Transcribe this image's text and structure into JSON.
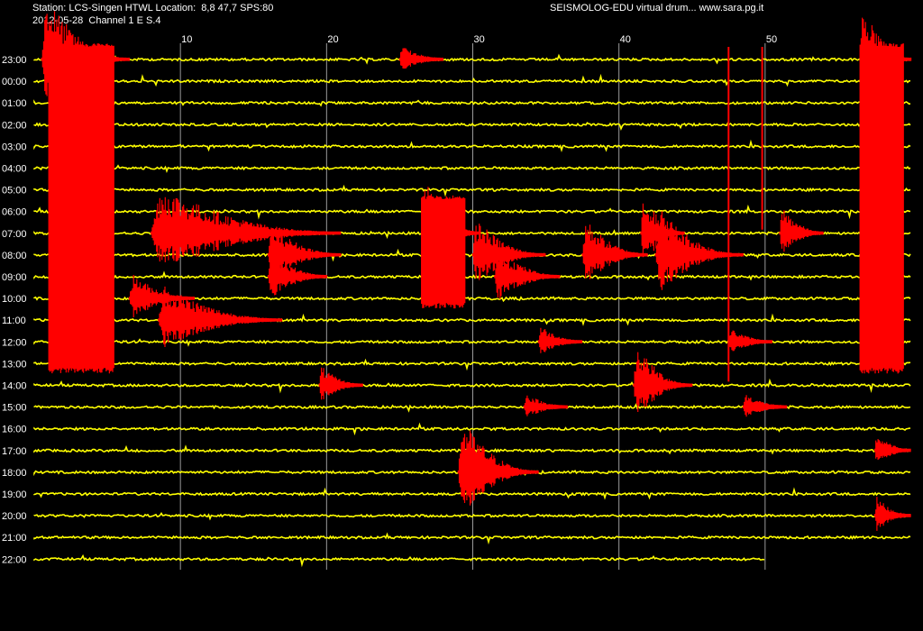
{
  "header": {
    "station_line": "Station: LCS-Singen HTWL Location:  8,8 47,7 SPS:80",
    "date_line": "2012-05-28  Channel 1 E S.4",
    "brand_line": "SEISMOLOG-EDU virtual drum... www.sara.pg.it"
  },
  "colors": {
    "background": "#000000",
    "trace": "#ffff00",
    "event": "#ff0000",
    "gridline": "#9a9a9a",
    "text": "#ffffff"
  },
  "chart_data": {
    "type": "heatmap",
    "title": "",
    "xlabel": "",
    "ylabel": "",
    "x_ticks": [
      10,
      20,
      30,
      40,
      50
    ],
    "xlim": [
      0,
      60
    ],
    "x_unit": "minutes",
    "grid": true,
    "rows": [
      "23:00",
      "00:00",
      "01:00",
      "02:00",
      "03:00",
      "04:00",
      "05:00",
      "06:00",
      "07:00",
      "08:00",
      "09:00",
      "10:00",
      "11:00",
      "12:00",
      "13:00",
      "14:00",
      "15:00",
      "16:00",
      "17:00",
      "18:00",
      "19:00",
      "20:00",
      "21:00",
      "22:00"
    ],
    "trace_end_last_row_min": 50,
    "events": [
      {
        "row": "23:00",
        "start": 0.5,
        "end": 6.5,
        "amp": 1.0
      },
      {
        "row": "23:00",
        "start": 25.0,
        "end": 28.0,
        "amp": 0.1
      },
      {
        "row": "23:00",
        "start": 56.5,
        "end": 60.0,
        "amp": 1.0
      },
      {
        "row": "07:00",
        "start": 8.0,
        "end": 21.0,
        "amp": 0.7
      },
      {
        "row": "07:00",
        "start": 26.5,
        "end": 30.5,
        "amp": 0.9
      },
      {
        "row": "07:00",
        "start": 41.5,
        "end": 44.5,
        "amp": 0.6
      },
      {
        "row": "07:00",
        "start": 51.0,
        "end": 54.0,
        "amp": 0.35
      },
      {
        "row": "08:00",
        "start": 16.0,
        "end": 21.0,
        "amp": 0.4
      },
      {
        "row": "08:00",
        "start": 30.0,
        "end": 35.0,
        "amp": 0.5
      },
      {
        "row": "08:00",
        "start": 37.5,
        "end": 42.0,
        "amp": 0.5
      },
      {
        "row": "08:00",
        "start": 42.5,
        "end": 48.5,
        "amp": 0.7
      },
      {
        "row": "09:00",
        "start": 16.0,
        "end": 20.0,
        "amp": 0.35
      },
      {
        "row": "09:00",
        "start": 31.5,
        "end": 36.0,
        "amp": 0.4
      },
      {
        "row": "10:00",
        "start": 6.5,
        "end": 11.0,
        "amp": 0.3
      },
      {
        "row": "11:00",
        "start": 8.5,
        "end": 17.0,
        "amp": 0.5
      },
      {
        "row": "12:00",
        "start": 34.5,
        "end": 37.5,
        "amp": 0.15
      },
      {
        "row": "12:00",
        "start": 47.5,
        "end": 50.5,
        "amp": 0.1
      },
      {
        "row": "14:00",
        "start": 19.5,
        "end": 22.5,
        "amp": 0.2
      },
      {
        "row": "14:00",
        "start": 41.0,
        "end": 45.0,
        "amp": 0.6
      },
      {
        "row": "15:00",
        "start": 33.5,
        "end": 36.5,
        "amp": 0.1
      },
      {
        "row": "15:00",
        "start": 48.5,
        "end": 51.5,
        "amp": 0.1
      },
      {
        "row": "17:00",
        "start": 57.5,
        "end": 60.0,
        "amp": 0.15
      },
      {
        "row": "18:00",
        "start": 29.0,
        "end": 34.5,
        "amp": 0.8
      },
      {
        "row": "20:00",
        "start": 57.5,
        "end": 60.0,
        "amp": 0.2
      }
    ],
    "wide_blocks": [
      {
        "rows": [
          "23:00",
          "13:00"
        ],
        "start": 1.0,
        "end": 5.5
      },
      {
        "rows": [
          "23:00",
          "13:00"
        ],
        "start": 56.5,
        "end": 59.5
      },
      {
        "rows": [
          "06:00",
          "10:00"
        ],
        "start": 26.5,
        "end": 29.5
      }
    ],
    "spikes": [
      {
        "row": "23:00",
        "at": 47.5,
        "to": "13:00"
      },
      {
        "row": "23:00",
        "at": 49.8,
        "to": "06:00"
      }
    ]
  }
}
